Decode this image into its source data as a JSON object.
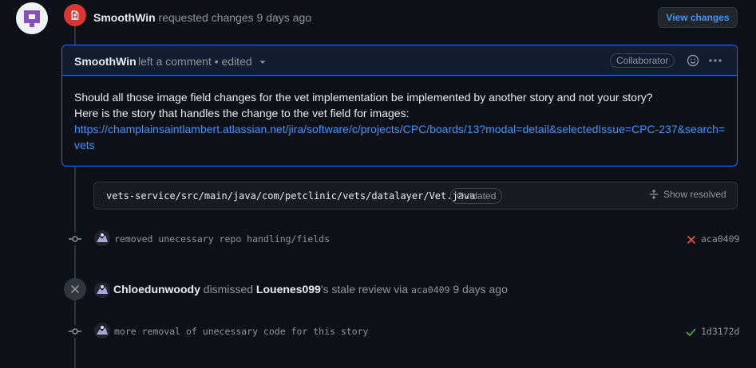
{
  "review": {
    "author": "SmoothWin",
    "action": "requested changes",
    "time": "9 days ago",
    "view_changes_label": "View changes"
  },
  "comment": {
    "author": "SmoothWin",
    "meta": "left a comment • edited",
    "role_badge": "Collaborator",
    "body_line1": "Should all those image field changes for the vet implementation be implemented by another story and not your story?",
    "body_line2": "Here is the story that handles the change to the vet field for images:",
    "link": "https://champlainsaintlambert.atlassian.net/jira/software/c/projects/CPC/boards/13?modal=detail&selectedIssue=CPC-237&search=vets"
  },
  "file": {
    "path": "vets-service/src/main/java/com/petclinic/vets/datalayer/Vet.java",
    "status_badge": "Outdated",
    "show_resolved_label": "Show resolved"
  },
  "commits": [
    {
      "message": "removed unecessary repo handling/fields",
      "sha": "aca0409",
      "status": "failure",
      "status_color": "#f85149"
    },
    {
      "message": "more removal of unecessary code for this story",
      "sha": "1d3172d",
      "status": "success",
      "status_color": "#3fb950"
    }
  ],
  "dismissal": {
    "actor": "Chloedunwoody",
    "action": "dismissed",
    "target": "Louenes099",
    "suffix": "'s stale review via",
    "commit": "aca0409",
    "time": "9 days ago"
  },
  "colors": {
    "accent": "#4493f8",
    "danger": "#da3633",
    "success": "#3fb950",
    "background": "#0d1117"
  }
}
